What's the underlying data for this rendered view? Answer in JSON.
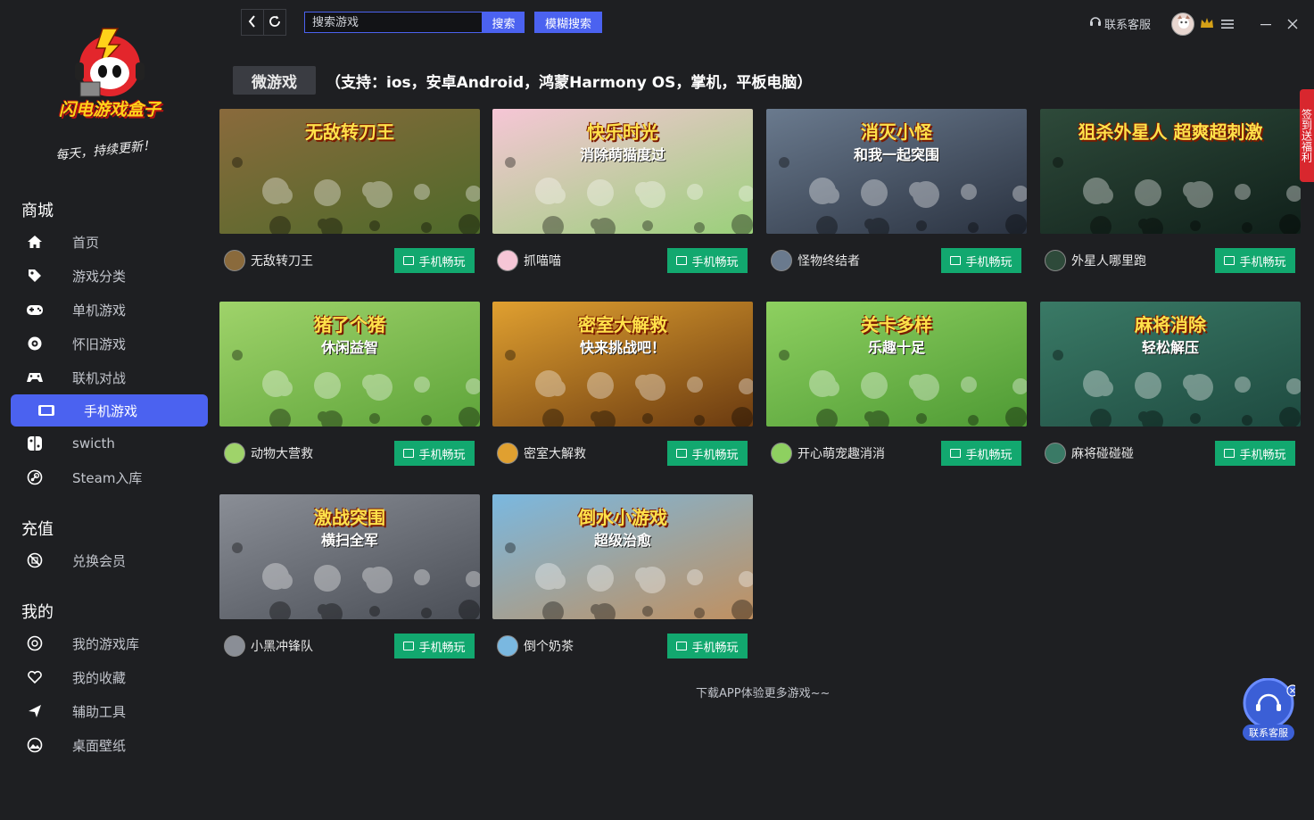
{
  "app": {
    "logo_text": "闪电游戏盒子",
    "slogan": "每天，持续更新！"
  },
  "topbar": {
    "search_placeholder": "搜索游戏",
    "search_label": "搜索",
    "fuzzy_label": "模糊搜索",
    "support_label": "联系客服"
  },
  "sidebar": {
    "sections": [
      {
        "title": "商城"
      },
      {
        "title": "充值"
      },
      {
        "title": "我的"
      }
    ],
    "items": [
      {
        "label": "首页",
        "icon": "home-icon"
      },
      {
        "label": "游戏分类",
        "icon": "tag-icon"
      },
      {
        "label": "单机游戏",
        "icon": "gamepad-icon"
      },
      {
        "label": "怀旧游戏",
        "icon": "retro-icon"
      },
      {
        "label": "联机对战",
        "icon": "controller-icon"
      },
      {
        "label": "手机游戏",
        "icon": "tablet-icon"
      },
      {
        "label": "swicth",
        "icon": "switch-icon"
      },
      {
        "label": "Steam入库",
        "icon": "steam-icon"
      },
      {
        "label": "兑换会员",
        "icon": "ticket-icon"
      },
      {
        "label": "我的游戏库",
        "icon": "library-icon"
      },
      {
        "label": "我的收藏",
        "icon": "heart-icon"
      },
      {
        "label": "辅助工具",
        "icon": "tools-icon"
      },
      {
        "label": "桌面壁纸",
        "icon": "wallpaper-icon"
      }
    ],
    "active": "手机游戏"
  },
  "main": {
    "tag": "微游戏",
    "support_text": "（支持：ios，安卓Android，鸿蒙Harmony OS，掌机，平板电脑）",
    "play_label": "手机畅玩",
    "footer": "下载APP体验更多游戏~~",
    "games": [
      {
        "name": "无敌转刀王",
        "thumb_title": "无敌转刀王",
        "thumb_sub": "",
        "c1": "#8a6a3c",
        "c2": "#4e6a2a"
      },
      {
        "name": "抓喵喵",
        "thumb_title": "快乐时光",
        "thumb_sub": "消除萌猫度过",
        "c1": "#f6c6d6",
        "c2": "#9ad07a"
      },
      {
        "name": "怪物终结者",
        "thumb_title": "消灭小怪",
        "thumb_sub": "和我一起突围",
        "c1": "#6a7a8e",
        "c2": "#2a3240"
      },
      {
        "name": "外星人哪里跑",
        "thumb_title": "狙杀外星人 超爽超刺激",
        "thumb_sub": "",
        "c1": "#2e4a3a",
        "c2": "#10201a"
      },
      {
        "name": "动物大营救",
        "thumb_title": "猪了个猪",
        "thumb_sub": "休闲益智",
        "c1": "#9fd36a",
        "c2": "#5ea43a"
      },
      {
        "name": "密室大解救",
        "thumb_title": "密室大解救",
        "thumb_sub": "快来挑战吧！",
        "c1": "#e0a030",
        "c2": "#6a3a10"
      },
      {
        "name": "开心萌宠趣消消",
        "thumb_title": "关卡多样",
        "thumb_sub": "乐趣十足",
        "c1": "#8ed060",
        "c2": "#4e9a34"
      },
      {
        "name": "麻将碰碰碰",
        "thumb_title": "麻将消除",
        "thumb_sub": "轻松解压",
        "c1": "#3a7a66",
        "c2": "#1e4a40"
      },
      {
        "name": "小黑冲锋队",
        "thumb_title": "激战突围",
        "thumb_sub": "横扫全军",
        "c1": "#8a8e96",
        "c2": "#4a4e56"
      },
      {
        "name": "倒个奶茶",
        "thumb_title": "倒水小游戏",
        "thumb_sub": "超级治愈",
        "c1": "#7ab8e0",
        "c2": "#c09060"
      }
    ]
  },
  "widgets": {
    "sign_tab": "签到送福利",
    "cs_float_label": "联系客服"
  }
}
